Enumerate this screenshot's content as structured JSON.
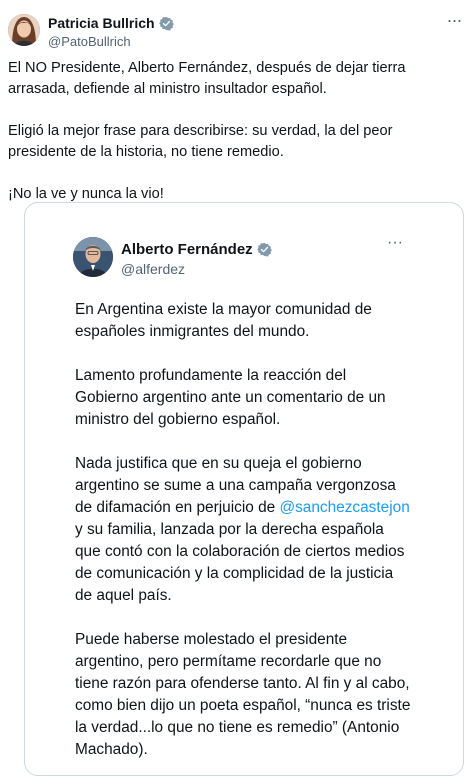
{
  "post": {
    "author_name": "Patricia Bullrich",
    "author_handle": "@PatoBullrich",
    "more_label": "···",
    "paragraphs": [
      "El NO Presidente, Alberto Fernández, después de dejar tierra arrasada, defiende al ministro insultador español.",
      "Eligió la mejor frase para describirse: su verdad, la del peor presidente de la historia, no tiene remedio.",
      "¡No la ve y nunca la vio!"
    ]
  },
  "quoted_post": {
    "author_name": "Alberto Fernández",
    "author_handle": "@alferdez",
    "more_label": "···",
    "paragraph_1": "En Argentina existe la mayor comunidad de españoles inmigrantes del mundo.",
    "paragraph_2": "Lamento profundamente la reacción del Gobierno argentino ante un comentario de un ministro del gobierno español.",
    "paragraph_3_before": "Nada justifica que en su queja el gobierno argentino se sume a una campaña vergonzosa de difamación en perjuicio de ",
    "paragraph_3_mention": "@sanchezcastejon",
    "paragraph_3_after": " y su familia, lanzada por la derecha española que contó con la colaboración de ciertos medios de comunicación y la complicidad de la justicia de aquel país.",
    "paragraph_4": "Puede haberse molestado el presidente argentino, pero permítame recordarle que no tiene razón para ofenderse tanto. Al fin y al cabo, como bien dijo un poeta español,  “nunca es triste la verdad...lo que no tiene es remedio” (Antonio Machado)."
  },
  "colors": {
    "text": "#0f1419",
    "secondary": "#536471",
    "link": "#1d9bf0",
    "verified": "#829aab",
    "border": "#cfd9de"
  },
  "icons": {
    "verified": "verified-badge-icon",
    "more": "more-options-icon"
  }
}
